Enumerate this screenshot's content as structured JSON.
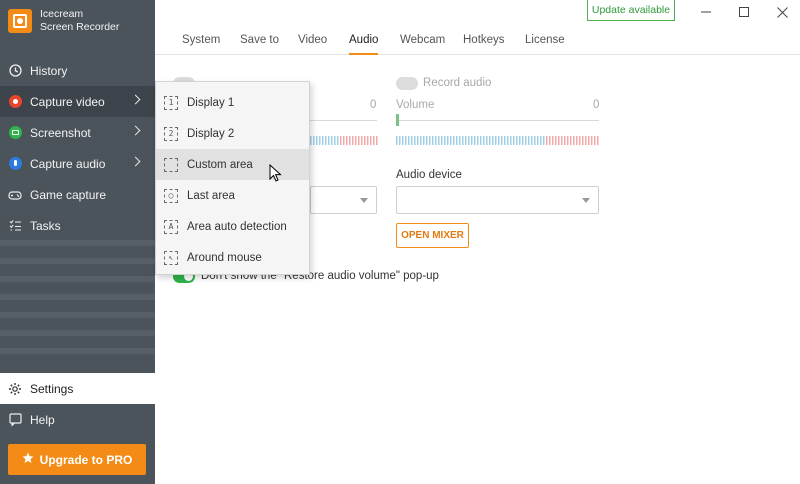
{
  "app": {
    "name_line1": "Icecream",
    "name_line2": "Screen Recorder"
  },
  "sidebar": {
    "items": [
      {
        "label": "History",
        "icon": "history-icon"
      },
      {
        "label": "Capture video",
        "icon": "record-icon",
        "has_submenu": true
      },
      {
        "label": "Screenshot",
        "icon": "camera-icon",
        "has_submenu": true
      },
      {
        "label": "Capture audio",
        "icon": "microphone-icon",
        "has_submenu": true
      },
      {
        "label": "Game capture",
        "icon": "gamepad-icon"
      },
      {
        "label": "Tasks",
        "icon": "tasks-icon"
      }
    ],
    "settings_label": "Settings",
    "help_label": "Help",
    "upgrade_label": "Upgrade to PRO"
  },
  "header": {
    "update_label": "Update available",
    "tabs": [
      "System",
      "Save to",
      "Video",
      "Audio",
      "Webcam",
      "Hotkeys",
      "License"
    ],
    "active_tab": "Audio"
  },
  "audio": {
    "left_volume_value": "0",
    "record_audio_label": "Record audio",
    "volume_label": "Volume",
    "right_volume_value": "0",
    "audio_device_label": "Audio device",
    "audio_device_value": "",
    "open_mixer_label": "OPEN MIXER",
    "restore_popup_label": "Don't show the \"Restore audio volume\" pop-up"
  },
  "capture_menu": {
    "items": [
      {
        "label": "Display 1",
        "glyph": "1"
      },
      {
        "label": "Display 2",
        "glyph": "2"
      },
      {
        "label": "Custom area",
        "glyph": "",
        "hovered": true
      },
      {
        "label": "Last area",
        "glyph": "◯"
      },
      {
        "label": "Area auto detection",
        "glyph": "A"
      },
      {
        "label": "Around mouse",
        "glyph": "↖"
      }
    ]
  },
  "colors": {
    "accent": "#f48b16",
    "sidebar": "#4b535b",
    "toggle_on": "#2fb34b",
    "update_green": "#2e9a3a"
  }
}
